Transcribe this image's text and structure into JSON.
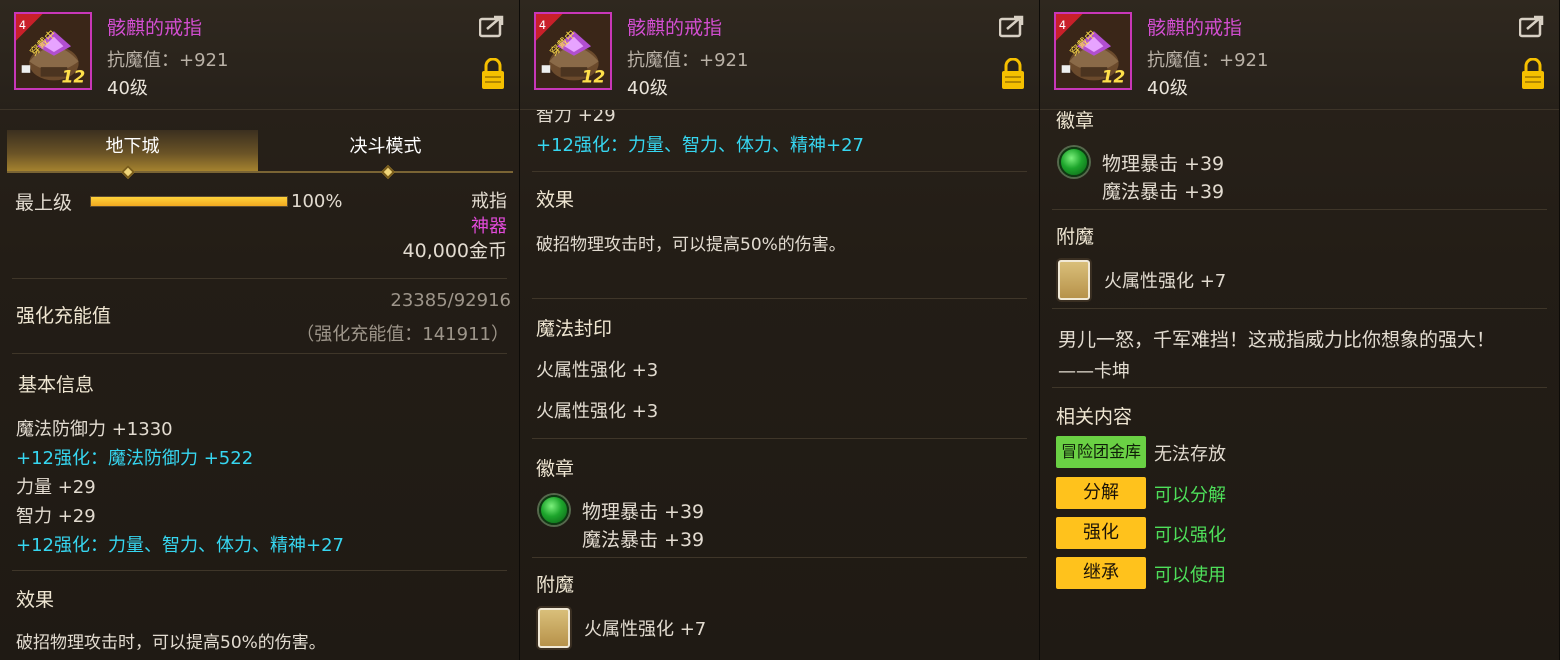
{
  "item": {
    "name": "骸麒的戒指",
    "stat": "抗魔值：+921",
    "level": "40级",
    "icon_level": "4",
    "icon_badge": "穿戴中",
    "icon_enhance": "12"
  },
  "tabs": {
    "dungeon": "地下城",
    "duel": "决斗模式"
  },
  "grade": {
    "label": "最上级",
    "percent": "100%",
    "progress_fraction": 1.0
  },
  "meta": {
    "type": "戒指",
    "rarity": "神器",
    "price": "40,000金币"
  },
  "charge": {
    "title": "强化充能值",
    "value": "23385/92916",
    "detail": "（强化充能值：141911）"
  },
  "basic": {
    "title": "基本信息",
    "lines": [
      "魔法防御力 +1330",
      "+12强化：魔法防御力 +522",
      "力量 +29",
      "智力 +29",
      "+12强化：力量、智力、体力、精神+27"
    ]
  },
  "effect": {
    "title": "效果",
    "text": "破招物理攻击时，可以提高50%的伤害。"
  },
  "p2_partial_line": "智力 +29",
  "seal": {
    "title": "魔法封印",
    "lines": [
      "火属性强化 +3",
      "火属性强化 +3"
    ]
  },
  "emblem": {
    "title": "徽章",
    "lines": [
      "物理暴击 +39",
      "魔法暴击 +39"
    ]
  },
  "enchant": {
    "title": "附魔",
    "text": "火属性强化 +7"
  },
  "quote": {
    "text": "男儿一怒，千军难挡！这戒指威力比你想象的强大！",
    "author": "——卡坤"
  },
  "related": {
    "title": "相关内容",
    "items": [
      {
        "button": "冒险团金库",
        "status": "无法存放"
      },
      {
        "button": "分解",
        "status": "可以分解"
      },
      {
        "button": "强化",
        "status": "可以强化"
      },
      {
        "button": "继承",
        "status": "可以使用"
      }
    ]
  },
  "colors": {
    "name": "#d24ed0",
    "enhance_text": "#36d6f0",
    "rarity": "#e04ad8",
    "status_green": "#4ee05a",
    "button_yellow": "#ffc21c",
    "button_green": "#6ad044"
  }
}
